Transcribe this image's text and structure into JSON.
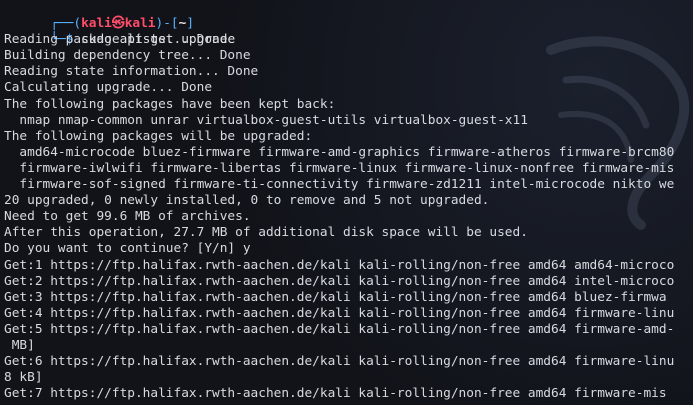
{
  "prompt": {
    "left_bracket": "┌──(",
    "user": "kali",
    "at_icon": "circled-at-icon",
    "host": "kali",
    "right_bracket": ")-[",
    "cwd": "~",
    "close_bracket": "]",
    "command_prefix": "└─$ ",
    "command": "sudo apt-get upgrade"
  },
  "output_lines": [
    "Reading package lists... Done",
    "Building dependency tree... Done",
    "Reading state information... Done",
    "Calculating upgrade... Done",
    "The following packages have been kept back:",
    "  nmap nmap-common unrar virtualbox-guest-utils virtualbox-guest-x11",
    "The following packages will be upgraded:",
    "  amd64-microcode bluez-firmware firmware-amd-graphics firmware-atheros firmware-brcm80",
    "  firmware-iwlwifi firmware-libertas firmware-linux firmware-linux-nonfree firmware-mis",
    "  firmware-sof-signed firmware-ti-connectivity firmware-zd1211 intel-microcode nikto we",
    "20 upgraded, 0 newly installed, 0 to remove and 5 not upgraded.",
    "Need to get 99.6 MB of archives.",
    "After this operation, 27.7 MB of additional disk space will be used.",
    "Do you want to continue? [Y/n] y",
    "Get:1 https://ftp.halifax.rwth-aachen.de/kali kali-rolling/non-free amd64 amd64-microco",
    "Get:2 https://ftp.halifax.rwth-aachen.de/kali kali-rolling/non-free amd64 intel-microco",
    "Get:3 https://ftp.halifax.rwth-aachen.de/kali kali-rolling/non-free amd64 bluez-firmwa",
    "Get:4 https://ftp.halifax.rwth-aachen.de/kali kali-rolling/non-free amd64 firmware-linu",
    "Get:5 https://ftp.halifax.rwth-aachen.de/kali kali-rolling/non-free amd64 firmware-amd-",
    " MB]",
    "Get:6 https://ftp.halifax.rwth-aachen.de/kali kali-rolling/non-free amd64 firmware-linu",
    "8 kB]",
    "Get:7 https://ftp.halifax.rwth-aachen.de/kali kali-rolling/non-free amd64 firmware-mis"
  ],
  "colors": {
    "background": "#111319",
    "text": "#d7dae0",
    "prompt_blue": "#58b2ff",
    "prompt_red": "#ff4d6a"
  }
}
